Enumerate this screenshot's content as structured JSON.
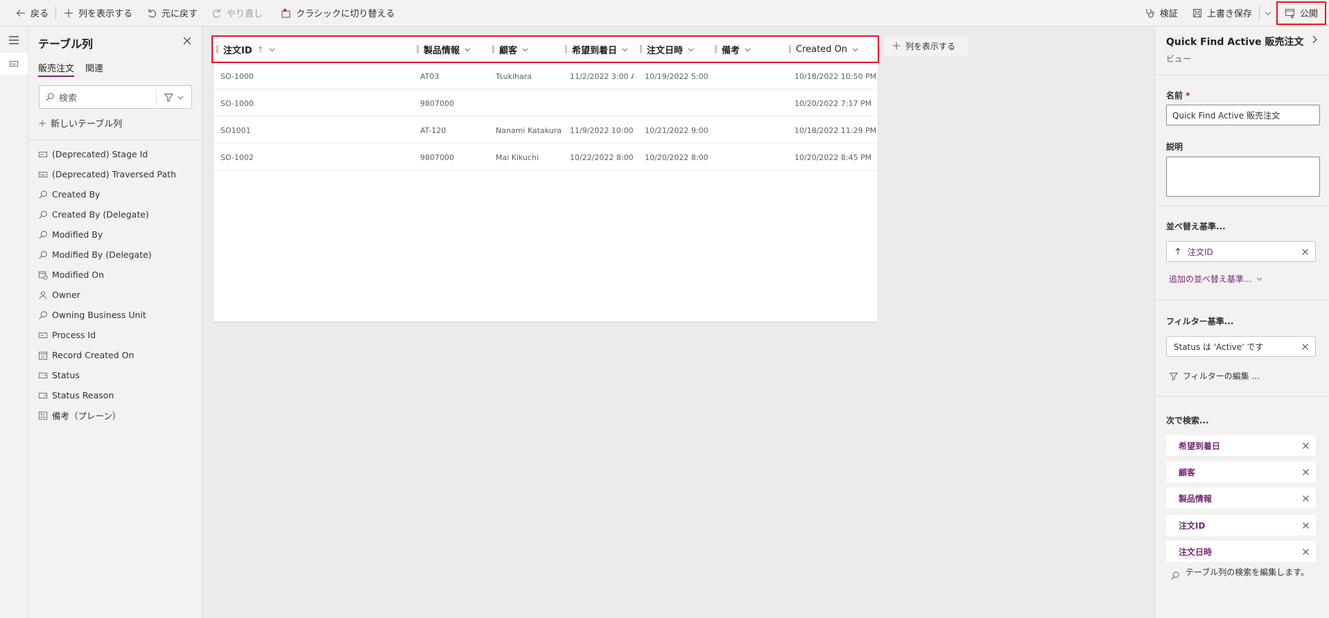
{
  "toolbar": {
    "back": "戻る",
    "show_columns": "列を表示する",
    "undo": "元に戻す",
    "redo": "やり直し",
    "switch_classic": "クラシックに切り替える",
    "validate": "検証",
    "save": "上書き保存",
    "publish": "公開"
  },
  "left_panel": {
    "title": "テーブル列",
    "tabs": [
      "販売注文",
      "関連"
    ],
    "search_placeholder": "検索",
    "new_column": "新しいテーブル列",
    "columns": [
      {
        "label": "(Deprecated) Stage Id",
        "icon": "field-icon"
      },
      {
        "label": "(Deprecated) Traversed Path",
        "icon": "text-field-icon"
      },
      {
        "label": "Created By",
        "icon": "lookup-icon"
      },
      {
        "label": "Created By (Delegate)",
        "icon": "lookup-icon"
      },
      {
        "label": "Modified By",
        "icon": "lookup-icon"
      },
      {
        "label": "Modified By (Delegate)",
        "icon": "lookup-icon"
      },
      {
        "label": "Modified On",
        "icon": "calendar-clock-icon"
      },
      {
        "label": "Owner",
        "icon": "person-icon"
      },
      {
        "label": "Owning Business Unit",
        "icon": "lookup-icon"
      },
      {
        "label": "Process Id",
        "icon": "field-icon"
      },
      {
        "label": "Record Created On",
        "icon": "calendar-icon"
      },
      {
        "label": "Status",
        "icon": "dropdown-field-icon"
      },
      {
        "label": "Status Reason",
        "icon": "dropdown-field-icon"
      },
      {
        "label": "備考（プレーン）",
        "icon": "multiline-text-icon"
      }
    ]
  },
  "grid": {
    "headers": [
      "注文ID",
      "製品情報",
      "顧客",
      "希望到着日",
      "注文日時",
      "備考",
      "Created On"
    ],
    "rows": [
      [
        "SO-1000",
        "AT03",
        "Tsukihara",
        "11/2/2022 3:00 A...",
        "10/19/2022 5:00 ...",
        "",
        "10/18/2022 10:50 PM"
      ],
      [
        "SO-1000",
        "9807000",
        "",
        "",
        "",
        "",
        "10/20/2022 7:17 PM"
      ],
      [
        "SO1001",
        "AT-120",
        "Nanami Katakura",
        "11/9/2022 10:00 ...",
        "10/21/2022 9:00 ...",
        "",
        "10/18/2022 11:29 PM"
      ],
      [
        "SO-1002",
        "9807000",
        "Mai Kikuchi",
        "10/22/2022 8:00 ...",
        "10/20/2022 8:00 ...",
        "",
        "10/20/2022 8:45 PM"
      ]
    ],
    "show_columns": "列を表示する"
  },
  "right_panel": {
    "title": "Quick Find Active 販売注文",
    "subtitle": "ビュー",
    "name_label": "名前",
    "required_mark": "*",
    "name_value": "Quick Find Active 販売注文",
    "description_label": "説明",
    "sort_label": "並べ替え基準...",
    "sort_value": "注文ID",
    "add_sort": "追加の並べ替え基準...",
    "filter_label": "フィルター基準...",
    "filter_value": "Status は 'Active' です",
    "edit_filter": "フィルターの編集 ...",
    "search_label": "次で検索...",
    "search_items": [
      "希望到着日",
      "顧客",
      "製品情報",
      "注文ID",
      "注文日時"
    ],
    "edit_search": "テーブル列の検索を編集します。"
  },
  "colors": {
    "accent": "#742774",
    "highlight_border": "#e81123",
    "panel_bg": "#f3f2f1",
    "canvas_bg": "#ebebeb"
  }
}
